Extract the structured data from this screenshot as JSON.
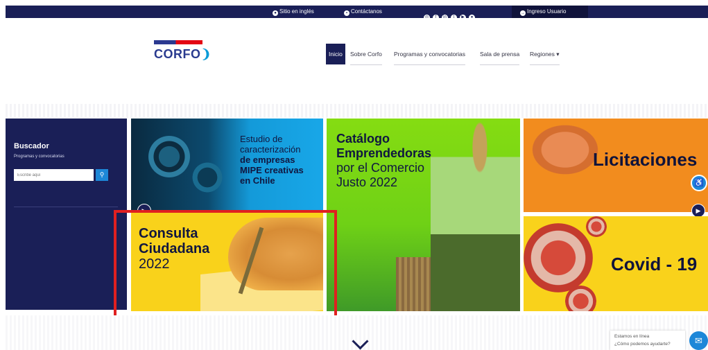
{
  "topbar": {
    "english_site": "Sitio en inglés",
    "contact": "Contáctanos",
    "login": "Ingreso Usuario"
  },
  "header": {
    "logo_text": "CORFO"
  },
  "nav": {
    "items": [
      "Inicio",
      "Sobre Corfo",
      "Programas y convocatorias",
      "Sala de prensa",
      "Regiones ▾"
    ]
  },
  "sidebar": {
    "title": "Buscador",
    "subtitle": "Programas y convocatorias",
    "search_placeholder": "Escribe aquí"
  },
  "cards": {
    "estudio": {
      "line1": "Estudio de",
      "line2": "caracterización",
      "line3": "de empresas",
      "line4": "MIPE creativas",
      "line5": "en Chile"
    },
    "consulta": {
      "line1": "Consulta",
      "line2": "Ciudadana",
      "line3": "2022"
    },
    "catalogo": {
      "line1": "Catálogo",
      "line2": "Emprendedoras",
      "line3": "por el Comercio",
      "line4": "Justo 2022"
    },
    "licitaciones": {
      "title": "Licitaciones"
    },
    "covid": {
      "title": "Covid - 19"
    }
  },
  "chat": {
    "line1": "Estamos en línea",
    "line2": "¿Cómo podemos ayudarte?"
  },
  "colors": {
    "navy": "#1a1f57",
    "blue": "#1d87d8",
    "yellow": "#f9d21b",
    "orange": "#f28c1e",
    "green": "#85dc12",
    "highlight_red": "#e02020"
  }
}
